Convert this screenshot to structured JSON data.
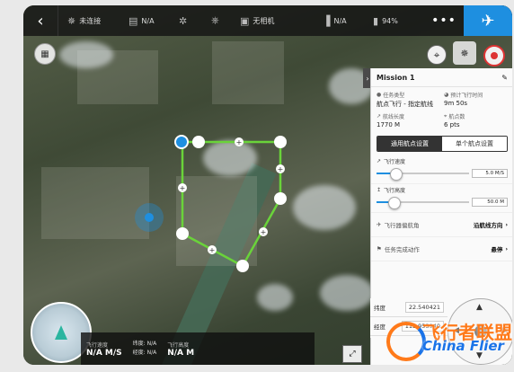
{
  "topbar": {
    "back_icon": "chevron-left-icon",
    "items": [
      {
        "icon": "drone-icon",
        "label": "未连接"
      },
      {
        "icon": "hd-signal-icon",
        "label": "N/A"
      },
      {
        "icon": "satellite-icon",
        "label": ""
      },
      {
        "icon": "remote-controller-icon",
        "label": ""
      },
      {
        "icon": "camera-icon",
        "label": "无相机"
      },
      {
        "icon": "battery-icon",
        "label": "N/A"
      },
      {
        "icon": "rc-battery-icon",
        "label": "94%"
      }
    ],
    "more": "•••",
    "fly_icon": "airplane-icon",
    "fly_color": "#1e8fe0"
  },
  "map": {
    "route_color": "#6ad33a",
    "waypoint_color": "#ffffff",
    "start_color": "#1e8fe0",
    "aircraft_color": "#1e8fe0"
  },
  "panel": {
    "title": "Mission 1",
    "edit_icon": "pencil-icon",
    "info": [
      {
        "label": "任务类型",
        "value": "航点飞行 - 指定航线"
      },
      {
        "label": "预计飞行时间",
        "value": "9m 50s"
      },
      {
        "label": "航线长度",
        "value": "1770 M"
      },
      {
        "label": "航点数",
        "value": "6 pts"
      }
    ],
    "tabs": [
      {
        "label": "通用航点设置",
        "active": true
      },
      {
        "label": "单个航点设置",
        "active": false
      }
    ],
    "speed": {
      "label": "飞行速度",
      "value": "5.0 M/S",
      "fraction": 0.2
    },
    "altitude": {
      "label": "飞行高度",
      "value": "50.0 M",
      "fraction": 0.18
    },
    "heading": {
      "label": "飞行器偏航角",
      "value": "沿航线方向"
    },
    "finish": {
      "label": "任务完成动作",
      "value": "悬停"
    }
  },
  "coords": {
    "lat_label": "纬度",
    "lat_value": "22.540421",
    "lng_label": "经度",
    "lng_value": "113.953940"
  },
  "telemetry": {
    "speed_label": "飞行速度",
    "speed_value": "N/A M/S",
    "lat_label": "纬度: N/A",
    "lng_label": "经度: N/A",
    "alt_label": "飞行高度",
    "alt_value": "N/A M"
  },
  "watermark": {
    "cn": "飞行者联盟",
    "en": "China Flier"
  }
}
